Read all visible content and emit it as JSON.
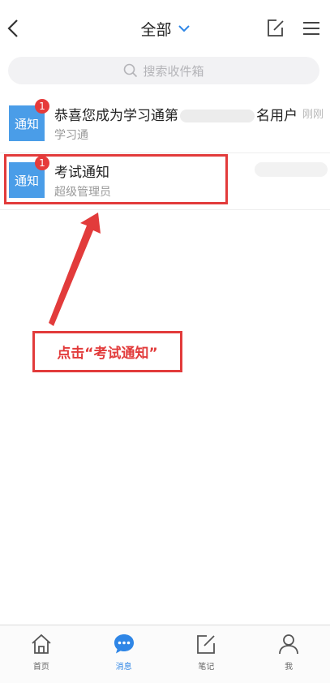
{
  "header": {
    "title": "全部",
    "back_icon": "chevron-left-icon",
    "dropdown_icon": "chevron-down-icon",
    "compose_icon": "compose-icon",
    "menu_icon": "hamburger-menu-icon"
  },
  "search": {
    "placeholder": "搜索收件箱",
    "icon": "search-icon"
  },
  "messages": [
    {
      "avatar_label": "通知",
      "unread": "1",
      "title_before": "恭喜您成为学习通第",
      "title_after": "名用户",
      "sender": "学习通",
      "time": "刚刚"
    },
    {
      "avatar_label": "通知",
      "unread": "1",
      "title": "考试通知",
      "sender": "超级管理员"
    }
  ],
  "annotation": {
    "callout_text": "点击“考试通知”",
    "color": "#e23b3b"
  },
  "tabbar": {
    "tabs": [
      {
        "label": "首页",
        "icon": "home-icon",
        "active": false
      },
      {
        "label": "消息",
        "icon": "chat-bubble-icon",
        "active": true
      },
      {
        "label": "笔记",
        "icon": "note-edit-icon",
        "active": false
      },
      {
        "label": "我",
        "icon": "person-icon",
        "active": false
      }
    ]
  },
  "colors": {
    "accent": "#2f86e6",
    "avatar_bg": "#4a9de8",
    "badge": "#e63b3b"
  }
}
